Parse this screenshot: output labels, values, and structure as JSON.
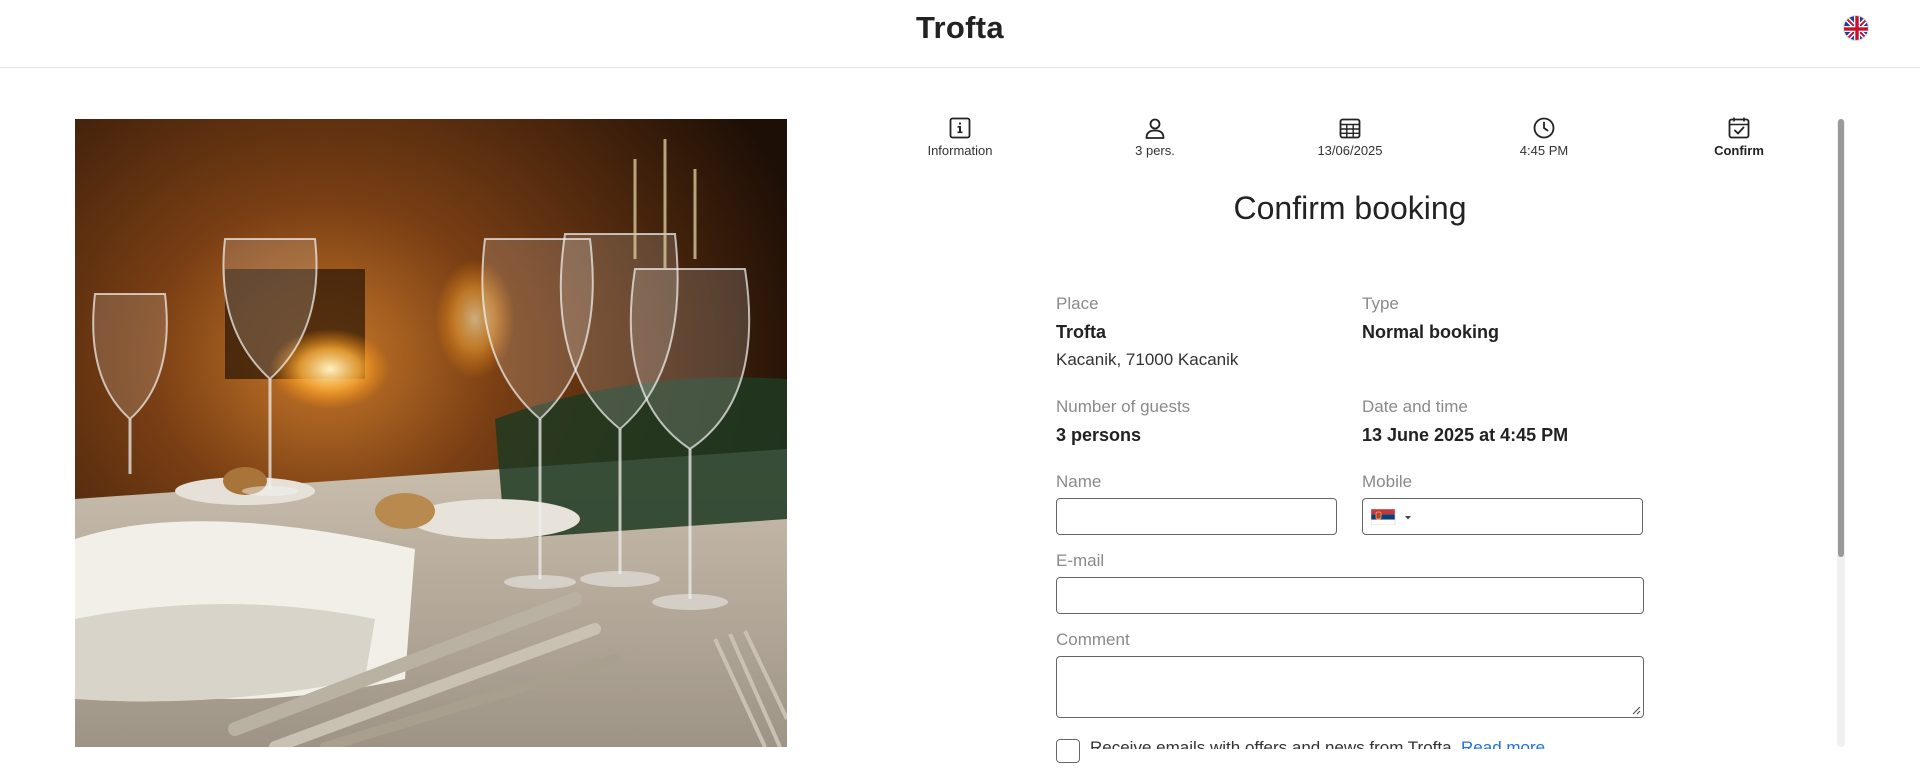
{
  "header": {
    "brand": "Trofta",
    "language_icon": "uk-flag-icon"
  },
  "steps": [
    {
      "label": "Information",
      "icon": "info-icon"
    },
    {
      "label": "3 pers.",
      "icon": "person-icon"
    },
    {
      "label": "13/06/2025",
      "icon": "calendar-icon"
    },
    {
      "label": "4:45 PM",
      "icon": "clock-icon"
    },
    {
      "label": "Confirm",
      "icon": "calendar-check-icon",
      "active": true
    }
  ],
  "page": {
    "title": "Confirm booking"
  },
  "summary": {
    "place_label": "Place",
    "place_name": "Trofta",
    "place_address": "Kacanik, 71000 Kacanik",
    "type_label": "Type",
    "type_value": "Normal booking",
    "guests_label": "Number of guests",
    "guests_value": "3 persons",
    "datetime_label": "Date and time",
    "datetime_value": "13 June 2025 at 4:45 PM"
  },
  "form": {
    "name_label": "Name",
    "name_value": "",
    "mobile_label": "Mobile",
    "mobile_value": "",
    "mobile_country_icon": "serbia-flag-icon",
    "email_label": "E-mail",
    "email_value": "",
    "comment_label": "Comment",
    "comment_value": "",
    "newsletter_text": "Receive emails with offers and news from Trofta.",
    "newsletter_link": "Read more"
  },
  "colors": {
    "accent_link": "#1a73e8",
    "text": "#222222",
    "muted": "#8a8a8a",
    "border": "#666666"
  }
}
